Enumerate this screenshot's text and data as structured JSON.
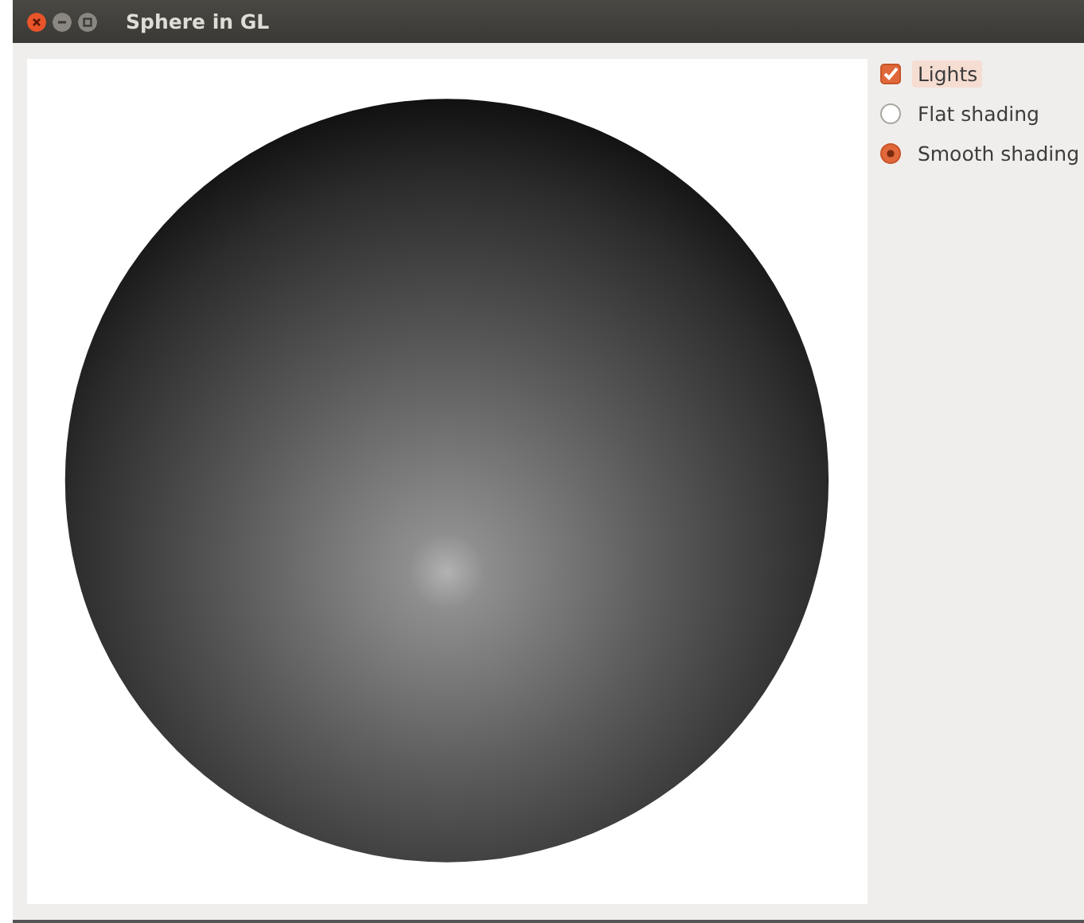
{
  "window": {
    "title": "Sphere in GL"
  },
  "options": [
    {
      "kind": "checkbox",
      "label": "Lights",
      "checked": true,
      "focused": true
    },
    {
      "kind": "radio",
      "label": "Flat shading",
      "selected": false,
      "focused": false
    },
    {
      "kind": "radio",
      "label": "Smooth shading",
      "selected": true,
      "focused": false
    }
  ]
}
